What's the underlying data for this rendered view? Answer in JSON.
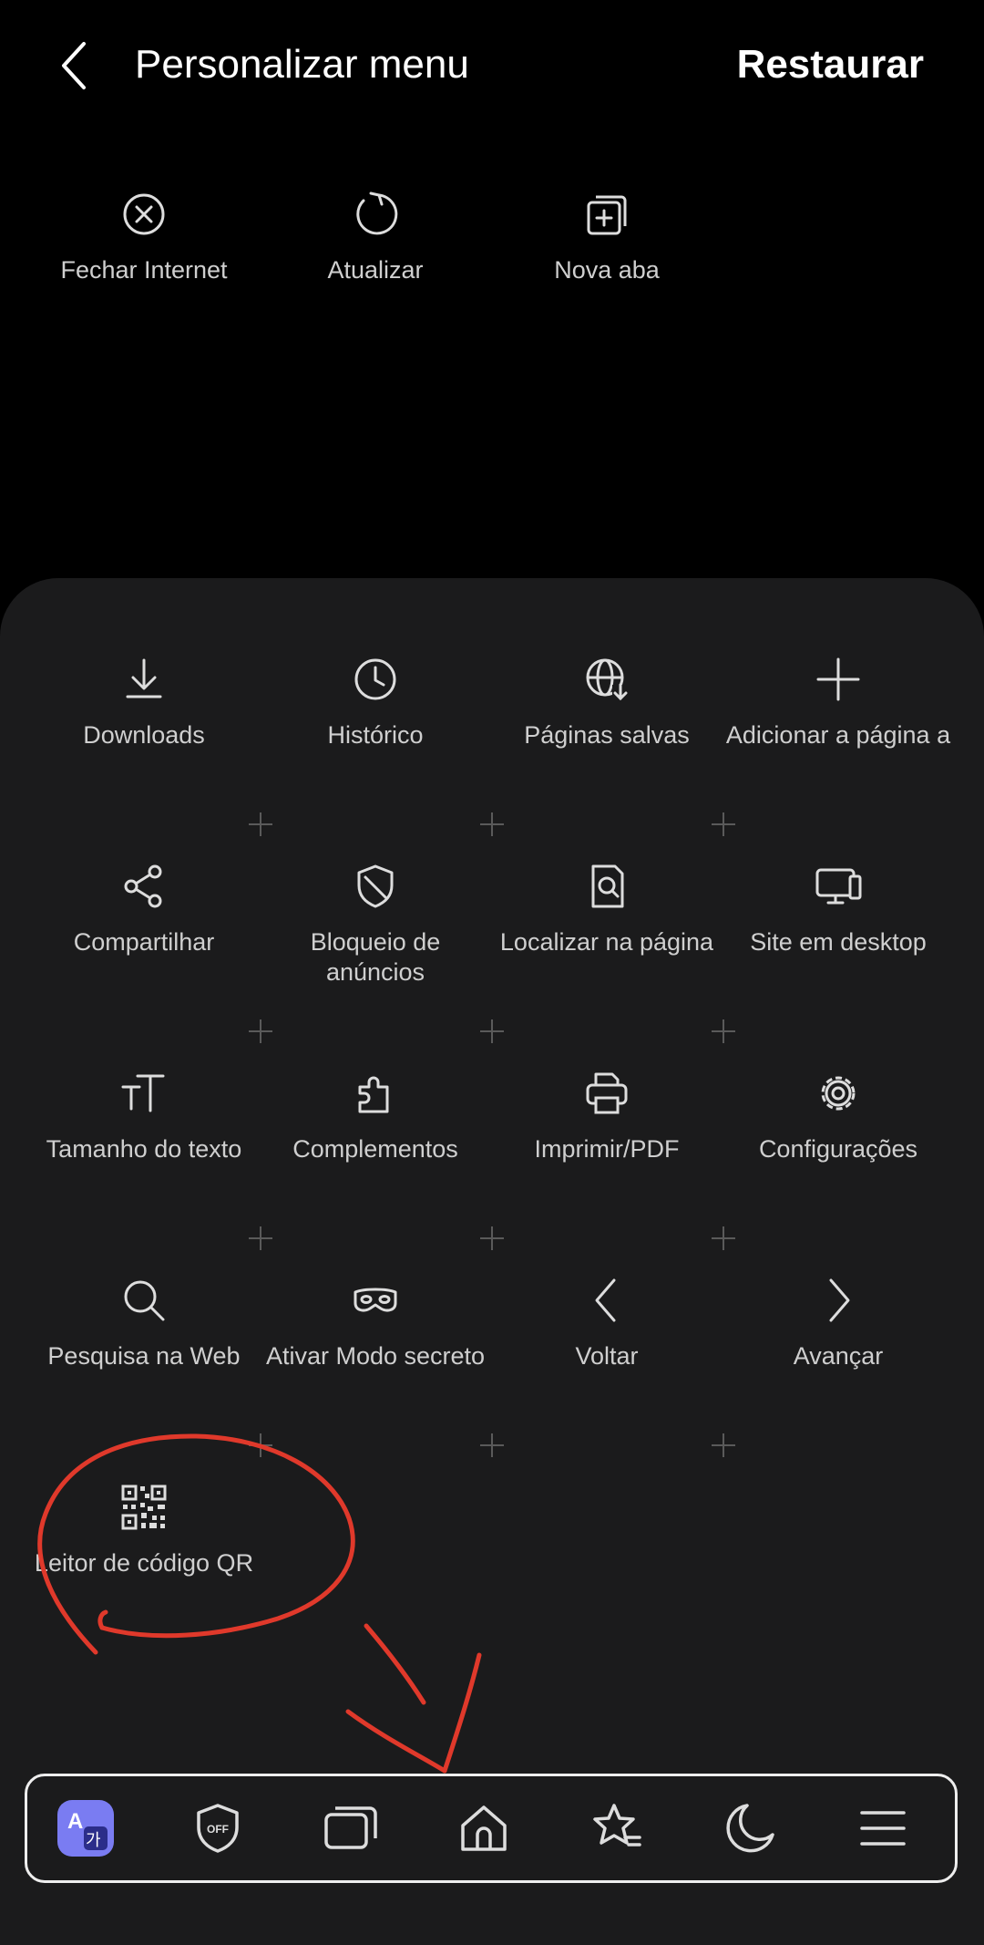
{
  "header": {
    "title": "Personalizar menu",
    "restore_label": "Restaurar"
  },
  "current_items": [
    {
      "label": "Fechar Internet",
      "icon": "close-circle-icon"
    },
    {
      "label": "Atualizar",
      "icon": "refresh-icon"
    },
    {
      "label": "Nova aba",
      "icon": "new-tab-icon"
    }
  ],
  "available_items": [
    {
      "label": "Downloads",
      "icon": "download-icon"
    },
    {
      "label": "Histórico",
      "icon": "clock-icon"
    },
    {
      "label": "Páginas salvas",
      "icon": "saved-pages-icon"
    },
    {
      "label": "Adicionar a página a",
      "icon": "plus-icon"
    },
    {
      "label": "Compartilhar",
      "icon": "share-icon"
    },
    {
      "label": "Bloqueio de anúncios",
      "icon": "shield-icon"
    },
    {
      "label": "Localizar na página",
      "icon": "find-in-page-icon"
    },
    {
      "label": "Site em desktop",
      "icon": "desktop-icon"
    },
    {
      "label": "Tamanho do texto",
      "icon": "text-size-icon"
    },
    {
      "label": "Complementos",
      "icon": "puzzle-icon"
    },
    {
      "label": "Imprimir/PDF",
      "icon": "printer-icon"
    },
    {
      "label": "Configurações",
      "icon": "gear-icon"
    },
    {
      "label": "Pesquisa na Web",
      "icon": "search-icon"
    },
    {
      "label": "Ativar Modo secreto",
      "icon": "mask-icon"
    },
    {
      "label": "Voltar",
      "icon": "chevron-left-icon"
    },
    {
      "label": "Avançar",
      "icon": "chevron-right-icon"
    },
    {
      "label": "Leitor de código QR",
      "icon": "qr-code-icon"
    }
  ],
  "navbar": {
    "items": [
      "translate-icon",
      "ad-block-off-icon",
      "tabs-icon",
      "home-icon",
      "bookmarks-icon",
      "night-mode-icon",
      "menu-icon"
    ],
    "translate_glyphs": {
      "latin": "A",
      "hangul": "가"
    },
    "ad_block_text": "OFF"
  },
  "colors": {
    "background": "#000000",
    "panel": "#1b1b1c",
    "annotation": "#e0392b",
    "accent": "#7a7cf2"
  }
}
